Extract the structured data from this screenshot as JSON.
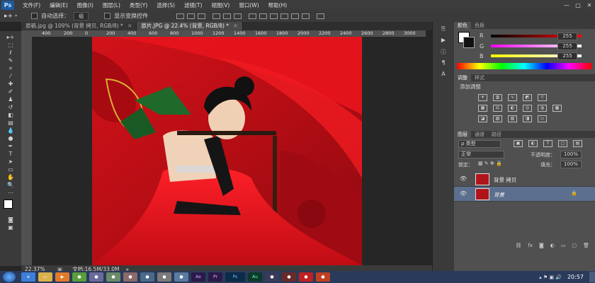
{
  "app": {
    "logo": "Ps"
  },
  "menu": [
    "文件(F)",
    "编辑(E)",
    "图像(I)",
    "图层(L)",
    "类型(Y)",
    "选择(S)",
    "滤镜(T)",
    "视图(V)",
    "窗口(W)",
    "帮助(H)"
  ],
  "window_controls": [
    "—",
    "□",
    "✕"
  ],
  "options_bar": {
    "auto_select_label": "自动选择：",
    "auto_select_value": "组",
    "show_transform_label": "显示变换控件"
  },
  "tabs": [
    {
      "label": "原稿.jpg @ 109% (背景 拷贝, RGB/8) *",
      "close": "✕"
    },
    {
      "label": "原片.JPG @ 22.4% (背景, RGB/8) *",
      "close": "✕"
    }
  ],
  "ruler_ticks": [
    "400",
    "200",
    "0",
    "200",
    "400",
    "600",
    "800",
    "1000",
    "1200",
    "1400",
    "1600",
    "1800",
    "2000",
    "2200",
    "2400",
    "2600",
    "2800",
    "3000"
  ],
  "status": {
    "zoom": "22.37%",
    "doc": "文档:16.5M/33.0M"
  },
  "color_panel": {
    "tabs": [
      "颜色",
      "色板"
    ],
    "channels": [
      {
        "label": "R",
        "value": "255"
      },
      {
        "label": "G",
        "value": "255"
      },
      {
        "label": "B",
        "value": "255"
      }
    ]
  },
  "adjust_panel": {
    "tabs": [
      "调整",
      "样式"
    ],
    "title": "添加调整"
  },
  "layers_panel": {
    "tabs": [
      "图层",
      "通道",
      "路径"
    ],
    "filter": "ρ 类型",
    "blend_mode": "正常",
    "opacity_label": "不透明度：",
    "opacity_value": "100%",
    "lock_label": "锁定：",
    "fill_label": "填充：",
    "fill_value": "100%",
    "layers": [
      {
        "name": "背景 拷贝"
      },
      {
        "name": "背景"
      }
    ]
  },
  "taskbar": {
    "apps": [
      "Ae",
      "Pr",
      "Ps",
      "Au",
      "",
      "",
      "",
      ""
    ],
    "time": "20:57"
  },
  "colors": {
    "accent_layer": "#5c6f8e",
    "photo_red": "#c81018"
  }
}
